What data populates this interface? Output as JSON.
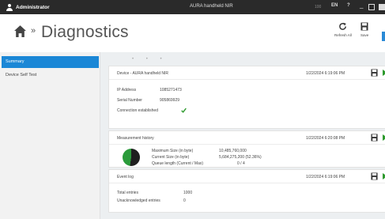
{
  "titlebar": {
    "user": "Administrator",
    "app_title": "AURA handheld NIR",
    "battery": "100",
    "language": "EN",
    "help": "?",
    "minimize": "_"
  },
  "header": {
    "breadcrumb_sep": "»",
    "page_title": "Diagnostics",
    "refresh_label": "Refresh All",
    "save_label": "Save"
  },
  "sidebar": {
    "items": [
      {
        "label": "Summary",
        "active": true
      },
      {
        "label": "Device Self Test",
        "active": false
      }
    ]
  },
  "content": {
    "dots": "• • •",
    "device": {
      "title": "Device - AURA handheld NIR",
      "time": "1/22/2024 6:19:06 PM",
      "ip_label": "IP Address",
      "ip_value": "1085271473",
      "serial_label": "Serial Number",
      "serial_value": "905869929",
      "connection": "Connection established"
    },
    "measurement": {
      "title": "Measurement history",
      "time": "1/22/2024 6:20:08 PM",
      "max_label": "Maximum Size (in byte)",
      "max_value": "10,485,760,000",
      "cur_label": "Current Size (in byte)",
      "cur_value": "5,684,275,200 (52.36%)",
      "used_fraction": 0.5236,
      "queue_label": "Queue length (Current / Max)",
      "queue_value": "0 / 4"
    },
    "event": {
      "title": "Event log",
      "time": "1/22/2024 6:19:06 PM",
      "total_label": "Total entries",
      "total_value": "1000",
      "unack_label": "Unacknowledged entries",
      "unack_value": "0"
    }
  },
  "colors": {
    "accent": "#1b87d6",
    "play_green": "#2e9a2e",
    "pie_used": "#1f1f1f",
    "pie_free": "#2a9b3a"
  },
  "icons": [
    "user-icon",
    "home-icon",
    "refresh-icon",
    "save-icon",
    "play-icon",
    "check-icon"
  ]
}
